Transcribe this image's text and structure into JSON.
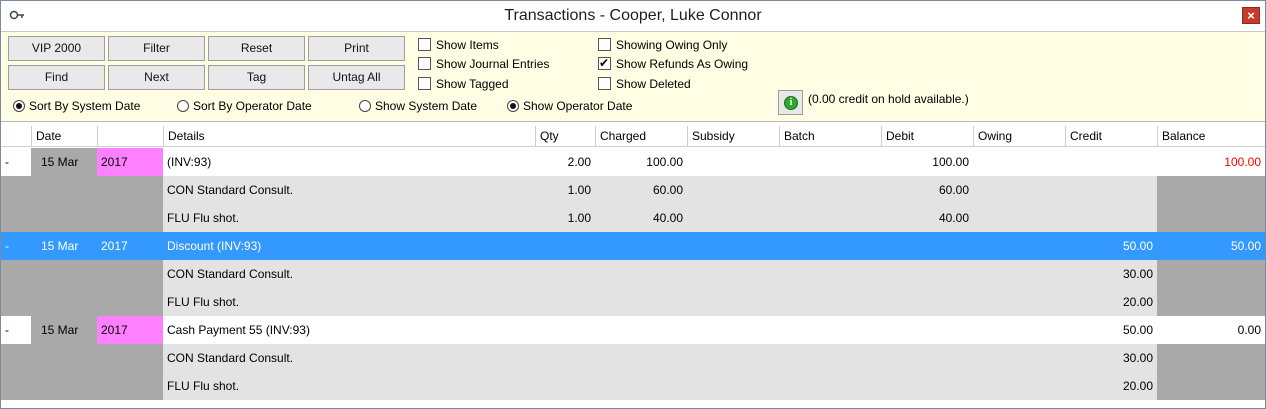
{
  "window": {
    "title": "Transactions - Cooper, Luke Connor",
    "close_label": "×"
  },
  "toolbar": {
    "buttons": {
      "vip": "VIP 2000",
      "filter": "Filter",
      "reset": "Reset",
      "print": "Print",
      "find": "Find",
      "next": "Next",
      "tag": "Tag",
      "untag_all": "Untag All"
    },
    "checks": {
      "show_items": {
        "label": "Show Items",
        "checked": false
      },
      "show_journal": {
        "label": "Show Journal Entries",
        "checked": false
      },
      "show_tagged": {
        "label": "Show Tagged",
        "checked": false
      },
      "owing_only": {
        "label": "Showing Owing Only",
        "checked": false
      },
      "refunds_owing": {
        "label": "Show Refunds As Owing",
        "checked": true
      },
      "show_deleted": {
        "label": "Show Deleted",
        "checked": false
      }
    },
    "radios": {
      "sort_system": {
        "label": "Sort By System Date",
        "on": true
      },
      "sort_operator": {
        "label": "Sort By Operator Date",
        "on": false
      },
      "show_system": {
        "label": "Show System Date",
        "on": false
      },
      "show_operator": {
        "label": "Show Operator Date",
        "on": true
      }
    },
    "info_icon": "info-icon",
    "credit_note": "(0.00 credit on hold available.)"
  },
  "grid": {
    "columns": {
      "date": "Date",
      "details": "Details",
      "qty": "Qty",
      "charged": "Charged",
      "subsidy": "Subsidy",
      "batch": "Batch",
      "debit": "Debit",
      "owing": "Owing",
      "credit": "Credit",
      "balance": "Balance"
    },
    "rows": [
      {
        "kind": "main",
        "marker": "-",
        "date": "15 Mar",
        "year": "2017",
        "details": "(INV:93)",
        "qty": "2.00",
        "charged": "100.00",
        "debit": "100.00",
        "credit": "",
        "balance": "100.00",
        "balance_color": "#ff0000"
      },
      {
        "kind": "sub",
        "details": "CON Standard Consult.",
        "qty": "1.00",
        "charged": "60.00",
        "debit": "60.00",
        "credit": ""
      },
      {
        "kind": "sub",
        "details": "FLU Flu shot.",
        "qty": "1.00",
        "charged": "40.00",
        "debit": "40.00",
        "credit": ""
      },
      {
        "kind": "selected",
        "marker": "-",
        "date": "15 Mar",
        "year": "2017",
        "details": "Discount (INV:93)",
        "qty": "",
        "charged": "",
        "debit": "",
        "credit": "50.00",
        "balance": "50.00"
      },
      {
        "kind": "sub",
        "details": "CON Standard Consult.",
        "qty": "",
        "charged": "",
        "debit": "",
        "credit": "30.00"
      },
      {
        "kind": "sub",
        "details": "FLU Flu shot.",
        "qty": "",
        "charged": "",
        "debit": "",
        "credit": "20.00"
      },
      {
        "kind": "main",
        "marker": "-",
        "date": "15 Mar",
        "year": "2017",
        "details": "Cash Payment  55  (INV:93)",
        "qty": "",
        "charged": "",
        "debit": "",
        "credit": "50.00",
        "balance": "0.00",
        "balance_color": "#000000"
      },
      {
        "kind": "sub",
        "details": "CON Standard Consult.",
        "qty": "",
        "charged": "",
        "debit": "",
        "credit": "30.00"
      },
      {
        "kind": "sub",
        "details": "FLU Flu shot.",
        "qty": "",
        "charged": "",
        "debit": "",
        "credit": "20.00"
      }
    ]
  },
  "colors": {
    "toolbar_bg": "#fffde3",
    "selected": "#3399ff",
    "year_tag": "#ff80ff",
    "sub_row": "#e3e3e3",
    "gutter": "#a9a9a9"
  }
}
